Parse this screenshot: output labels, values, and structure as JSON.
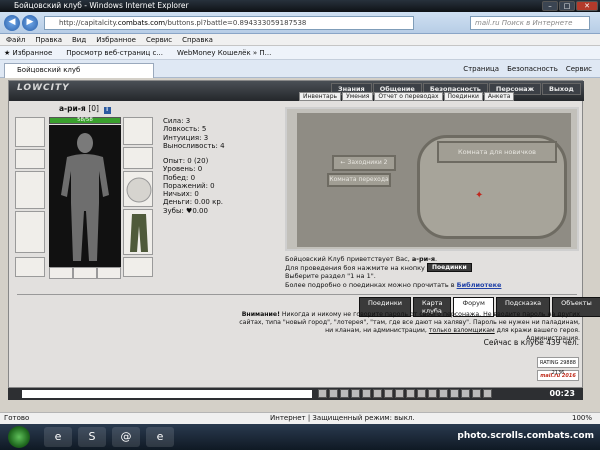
{
  "window": {
    "title": "Бойцовский клуб - Windows Internet Explorer"
  },
  "address": {
    "prefix": "http://capitalcity.",
    "domain": "combats.com",
    "path": "/buttons.pl?battle=0.894333059187538",
    "search_placeholder": "mail.ru Поиск в Интернете"
  },
  "menu": [
    "Файл",
    "Правка",
    "Вид",
    "Избранное",
    "Сервис",
    "Справка"
  ],
  "favorites": [
    "Избранное",
    "Просмотр веб-страниц с...",
    "WebMoney Кошелёк » П..."
  ],
  "tab": {
    "label": "Бойцовский клуб"
  },
  "commands": [
    "Страница",
    "Безопасность",
    "Сервис"
  ],
  "game": {
    "logo": "LOWCITY",
    "top_tabs": [
      "Знания",
      "Общение",
      "Безопасность",
      "Персонаж",
      "Выход"
    ],
    "sub_tabs": [
      "Инвентарь",
      "Умения",
      "Отчет о переводах",
      "Поединки",
      "Анкета"
    ],
    "character": {
      "name": "а-ри-я",
      "level": "[0]",
      "hp": "58/58",
      "hp_fraction": 1.0
    },
    "stats": [
      "Сила: 3",
      "Ловкость: 5",
      "Интуиция: 3",
      "Выносливость: 4"
    ],
    "stats2": [
      "Опыт: 0 (20)",
      "Уровень: 0",
      "Побед: 0",
      "Поражений: 0",
      "Ничьих: 0",
      "Деньги: 0.00 кр.",
      "Зубы: ♥0.00"
    ],
    "map": {
      "room_a": "← Заходники 2",
      "room_b": "Комната перехода",
      "room_main": "Комната для новичков"
    },
    "welcome": {
      "line1_prefix": "Бойцовский Клуб приветствует Вас, ",
      "line1_name": "а-ри-я",
      "line2": "Для проведения боя нажмите на кнопку",
      "fight_button": "Поединки",
      "line3": "Выберите раздел \"1 на 1\".",
      "line4_prefix": "Более подробно о поединках можно прочитать в ",
      "library_link": "Библиотеке"
    },
    "buttons": [
      "Поединки",
      "Карта клуба",
      "Форум",
      "Подсказка",
      "Объекты"
    ],
    "warning": {
      "bold": "Внимание!",
      "text1": " Никогда и никому не говорите пароль от своего персонажа. Не вводите пароль на других сайтах, типа \"новый город\", \"лотерея\", \"там, где все дают на халяву\". Пароль не нужен ни паладинам, ни кланам, ни администрации, ",
      "underlined": "только взломщикам",
      "text2": " для кражи вашего героя.",
      "signature": "Администрация."
    },
    "online": "Сейчас в клубе 439 чел.",
    "counter_rating": "RATING 29888 2136",
    "counter_mail": "mail.ru 2016"
  },
  "chat": {
    "time": "00:23"
  },
  "status": {
    "left": "Готово",
    "zone": "Интернет | Защищенный режим: выкл.",
    "zoom": "100%"
  },
  "taskbar": {
    "watermark": "photo.scrolls.combats.com"
  }
}
